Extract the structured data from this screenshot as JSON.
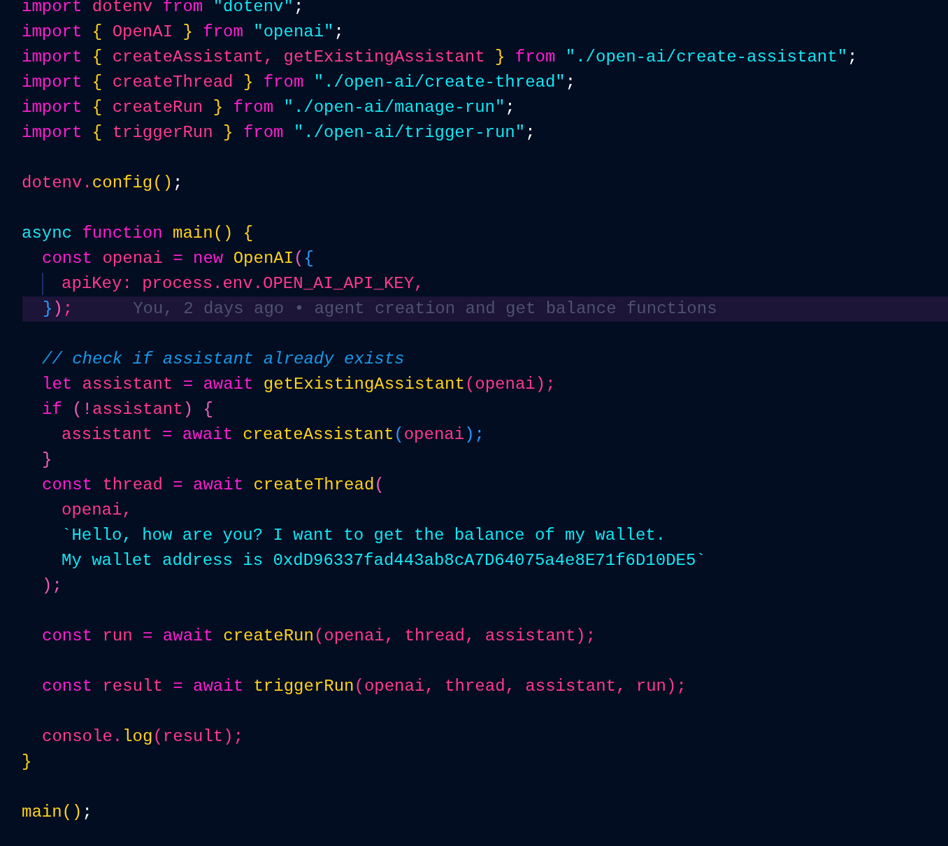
{
  "editor": {
    "lines": [
      {
        "kind": "code",
        "tokens": [
          {
            "kind": "keyword",
            "text": "import "
          },
          {
            "kind": "variable",
            "text": "dotenv "
          },
          {
            "kind": "keyword",
            "text": "from "
          },
          {
            "kind": "string",
            "text": "\"dotenv\""
          },
          {
            "kind": "plain",
            "text": ";"
          }
        ]
      },
      {
        "kind": "code",
        "tokens": [
          {
            "kind": "keyword",
            "text": "import "
          },
          {
            "kind": "brace",
            "text": "{ "
          },
          {
            "kind": "variable",
            "text": "OpenAI "
          },
          {
            "kind": "brace",
            "text": "} "
          },
          {
            "kind": "keyword",
            "text": "from "
          },
          {
            "kind": "string",
            "text": "\"openai\""
          },
          {
            "kind": "plain",
            "text": ";"
          }
        ]
      },
      {
        "kind": "code",
        "tokens": [
          {
            "kind": "keyword",
            "text": "import "
          },
          {
            "kind": "brace",
            "text": "{ "
          },
          {
            "kind": "variable",
            "text": "createAssistant, getExistingAssistant "
          },
          {
            "kind": "brace",
            "text": "} "
          },
          {
            "kind": "keyword",
            "text": "from "
          },
          {
            "kind": "string",
            "text": "\"./open-ai/create-assistant\""
          },
          {
            "kind": "plain",
            "text": ";"
          }
        ]
      },
      {
        "kind": "code",
        "tokens": [
          {
            "kind": "keyword",
            "text": "import "
          },
          {
            "kind": "brace",
            "text": "{ "
          },
          {
            "kind": "variable",
            "text": "createThread "
          },
          {
            "kind": "brace",
            "text": "} "
          },
          {
            "kind": "keyword",
            "text": "from "
          },
          {
            "kind": "string",
            "text": "\"./open-ai/create-thread\""
          },
          {
            "kind": "plain",
            "text": ";"
          }
        ]
      },
      {
        "kind": "code",
        "tokens": [
          {
            "kind": "keyword",
            "text": "import "
          },
          {
            "kind": "brace",
            "text": "{ "
          },
          {
            "kind": "variable",
            "text": "createRun "
          },
          {
            "kind": "brace",
            "text": "} "
          },
          {
            "kind": "keyword",
            "text": "from "
          },
          {
            "kind": "string",
            "text": "\"./open-ai/manage-run\""
          },
          {
            "kind": "plain",
            "text": ";"
          }
        ]
      },
      {
        "kind": "code",
        "tokens": [
          {
            "kind": "keyword",
            "text": "import "
          },
          {
            "kind": "brace",
            "text": "{ "
          },
          {
            "kind": "variable",
            "text": "triggerRun "
          },
          {
            "kind": "brace",
            "text": "} "
          },
          {
            "kind": "keyword",
            "text": "from "
          },
          {
            "kind": "string",
            "text": "\"./open-ai/trigger-run\""
          },
          {
            "kind": "plain",
            "text": ";"
          }
        ]
      },
      {
        "kind": "blank"
      },
      {
        "kind": "code",
        "tokens": [
          {
            "kind": "variable",
            "text": "dotenv."
          },
          {
            "kind": "function",
            "text": "config()"
          },
          {
            "kind": "plain",
            "text": ";"
          }
        ]
      },
      {
        "kind": "blank"
      },
      {
        "kind": "code",
        "tokens": [
          {
            "kind": "storage",
            "text": "async "
          },
          {
            "kind": "keyword",
            "text": "function "
          },
          {
            "kind": "function",
            "text": "main() {"
          }
        ]
      },
      {
        "kind": "indented",
        "tokens": [
          {
            "kind": "keyword",
            "text": "const "
          },
          {
            "kind": "variable",
            "text": "openai "
          },
          {
            "kind": "keyword",
            "text": "= new "
          },
          {
            "kind": "function",
            "text": "OpenAI"
          },
          {
            "kind": "paren",
            "text": "("
          },
          {
            "kind": "bracket",
            "text": "{"
          }
        ]
      },
      {
        "kind": "nested",
        "indent_guide": true,
        "tokens": [
          {
            "kind": "variable",
            "text": "apiKey: process.env.OPEN_AI_API_KEY,"
          }
        ]
      },
      {
        "kind": "indented",
        "current": true,
        "blame": "You, 2 days ago • agent creation and get balance functions",
        "tokens": [
          {
            "kind": "bracket",
            "text": "}"
          },
          {
            "kind": "paren",
            "text": ")"
          },
          {
            "kind": "variable",
            "text": ";"
          }
        ]
      },
      {
        "kind": "blank"
      },
      {
        "kind": "indented",
        "tokens": [
          {
            "kind": "comment",
            "text": "// check if assistant already exists"
          }
        ]
      },
      {
        "kind": "indented",
        "tokens": [
          {
            "kind": "keyword",
            "text": "let "
          },
          {
            "kind": "variable",
            "text": "assistant "
          },
          {
            "kind": "keyword",
            "text": "= await "
          },
          {
            "kind": "function",
            "text": "getExistingAssistant"
          },
          {
            "kind": "variable",
            "text": "(openai);"
          }
        ]
      },
      {
        "kind": "indented",
        "tokens": [
          {
            "kind": "keyword",
            "text": "if "
          },
          {
            "kind": "paren",
            "text": "(!"
          },
          {
            "kind": "variable",
            "text": "assistant"
          },
          {
            "kind": "paren",
            "text": ") {"
          }
        ]
      },
      {
        "kind": "nested",
        "tokens": [
          {
            "kind": "variable",
            "text": "assistant "
          },
          {
            "kind": "keyword",
            "text": "= await "
          },
          {
            "kind": "function",
            "text": "createAssistant"
          },
          {
            "kind": "bracket",
            "text": "("
          },
          {
            "kind": "variable",
            "text": "openai"
          },
          {
            "kind": "bracket",
            "text": ");"
          }
        ]
      },
      {
        "kind": "indented",
        "tokens": [
          {
            "kind": "paren",
            "text": "}"
          }
        ]
      },
      {
        "kind": "indented",
        "tokens": [
          {
            "kind": "keyword",
            "text": "const "
          },
          {
            "kind": "variable",
            "text": "thread "
          },
          {
            "kind": "keyword",
            "text": "= await "
          },
          {
            "kind": "function",
            "text": "createThread"
          },
          {
            "kind": "paren",
            "text": "("
          }
        ]
      },
      {
        "kind": "nested",
        "tokens": [
          {
            "kind": "variable",
            "text": "openai,"
          }
        ]
      },
      {
        "kind": "nested",
        "tokens": [
          {
            "kind": "string",
            "text": "`Hello, how are you? I want to get the balance of my wallet."
          }
        ]
      },
      {
        "kind": "nested",
        "tokens": [
          {
            "kind": "string",
            "text": "My wallet address is 0xdD96337fad443ab8cA7D64075a4e8E71f6D10DE5`"
          }
        ]
      },
      {
        "kind": "indented",
        "tokens": [
          {
            "kind": "paren",
            "text": ");"
          }
        ]
      },
      {
        "kind": "blank"
      },
      {
        "kind": "indented",
        "tokens": [
          {
            "kind": "keyword",
            "text": "const "
          },
          {
            "kind": "variable",
            "text": "run "
          },
          {
            "kind": "keyword",
            "text": "= await "
          },
          {
            "kind": "function",
            "text": "createRun"
          },
          {
            "kind": "variable",
            "text": "(openai, thread, assistant);"
          }
        ]
      },
      {
        "kind": "blank"
      },
      {
        "kind": "indented",
        "tokens": [
          {
            "kind": "keyword",
            "text": "const "
          },
          {
            "kind": "variable",
            "text": "result "
          },
          {
            "kind": "keyword",
            "text": "= await "
          },
          {
            "kind": "function",
            "text": "triggerRun"
          },
          {
            "kind": "variable",
            "text": "(openai, thread, assistant, run);"
          }
        ]
      },
      {
        "kind": "blank"
      },
      {
        "kind": "indented",
        "tokens": [
          {
            "kind": "variable",
            "text": "console."
          },
          {
            "kind": "function",
            "text": "log"
          },
          {
            "kind": "variable",
            "text": "(result);"
          }
        ]
      },
      {
        "kind": "code",
        "tokens": [
          {
            "kind": "function",
            "text": "}"
          }
        ]
      },
      {
        "kind": "blank"
      },
      {
        "kind": "code",
        "tokens": [
          {
            "kind": "function",
            "text": "main()"
          },
          {
            "kind": "plain",
            "text": ";"
          }
        ]
      }
    ]
  }
}
